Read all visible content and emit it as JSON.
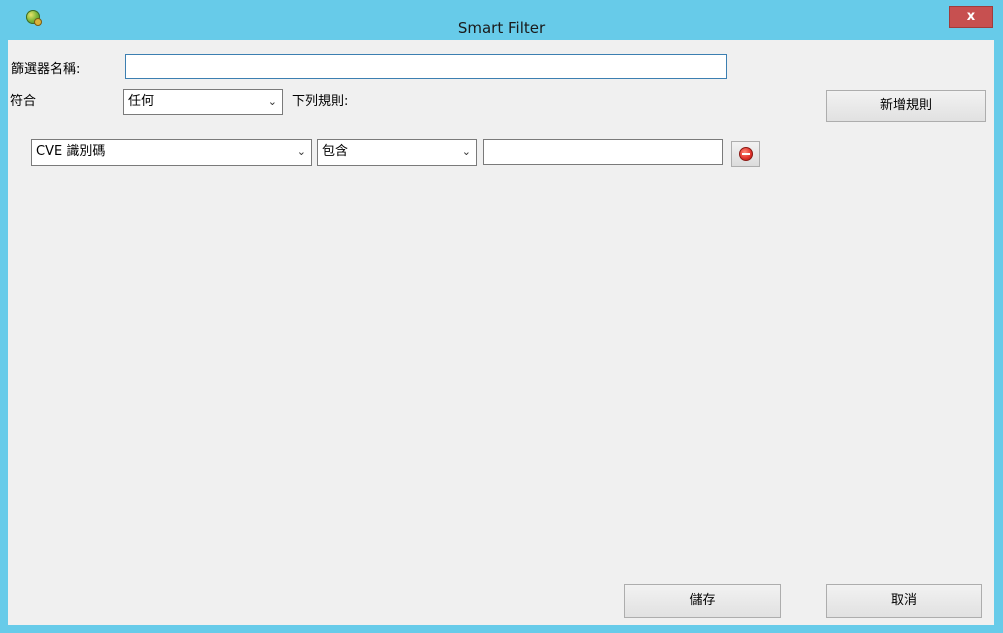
{
  "window": {
    "title": "Smart Filter",
    "close_glyph": "x",
    "icon": "app-icon"
  },
  "form": {
    "filter_name_label": "篩選器名稱:",
    "filter_name_value": "",
    "match_label": "符合",
    "match_selected": "任何",
    "rules_suffix_label": "下列規則:",
    "add_rule_button": "新增規則"
  },
  "rule": {
    "field_selected": "CVE 識別碼",
    "operator_selected": "包含",
    "value": "",
    "remove_icon": "remove-circle-icon"
  },
  "footer": {
    "save_button": "儲存",
    "cancel_button": "取消"
  },
  "colors": {
    "titlebar": "#67cbe9",
    "close_button": "#c75050",
    "client_background": "#f0f0f0"
  }
}
